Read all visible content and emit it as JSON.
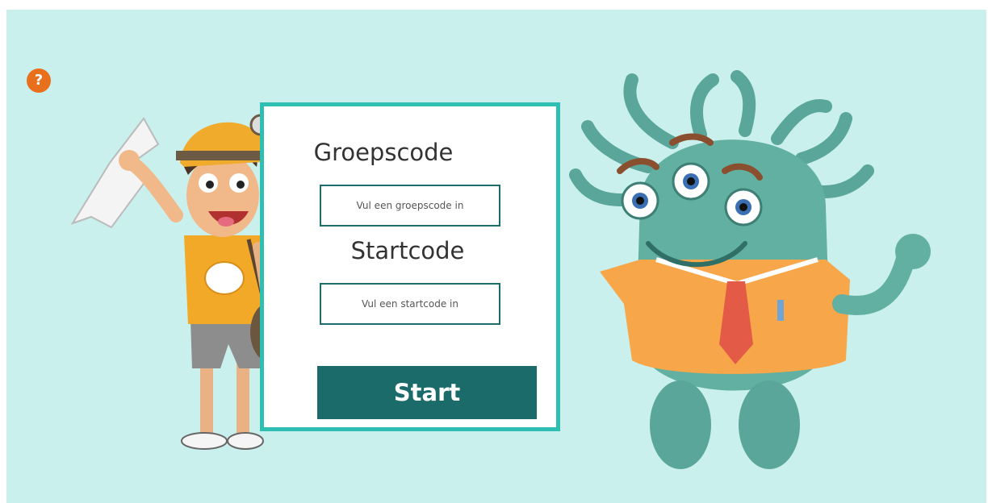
{
  "help": {
    "icon": "question-icon",
    "glyph": "?",
    "color": "#e8701d"
  },
  "form": {
    "group_label": "Groepscode",
    "group_placeholder": "Vul een groepscode in",
    "start_label": "Startcode",
    "start_placeholder": "Vul een startcode in",
    "submit_label": "Start"
  },
  "colors": {
    "background": "#c9f0ec",
    "card_border": "#2fbfb2",
    "button": "#1b6b6b"
  }
}
